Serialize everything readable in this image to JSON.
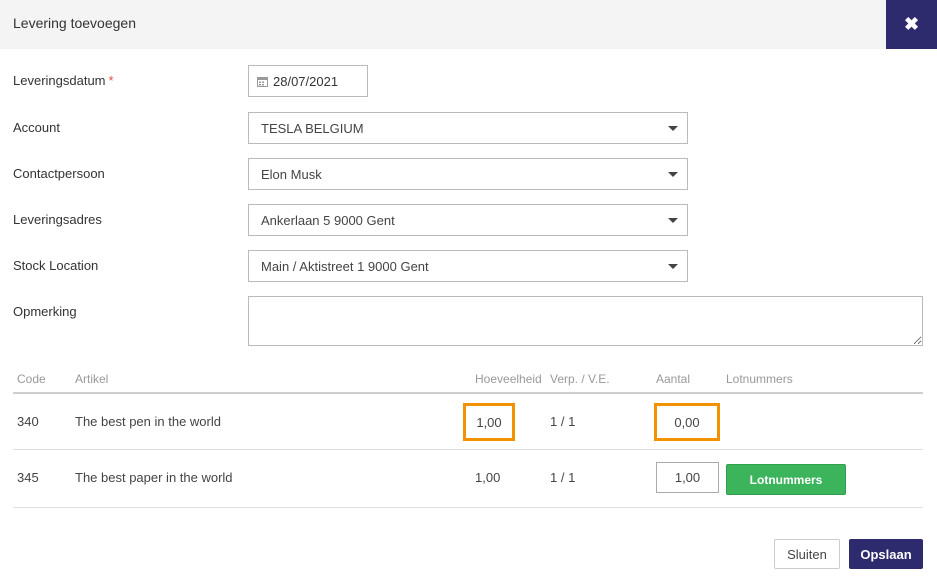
{
  "dialog": {
    "title": "Levering toevoegen",
    "close_icon": "✖"
  },
  "form": {
    "delivery_date": {
      "label": "Leveringsdatum",
      "required_mark": "*",
      "value": "28/07/2021"
    },
    "account": {
      "label": "Account",
      "value": "TESLA BELGIUM"
    },
    "contact": {
      "label": "Contactpersoon",
      "value": "Elon Musk"
    },
    "address": {
      "label": "Leveringsadres",
      "value": "Ankerlaan 5 9000 Gent"
    },
    "stock_location": {
      "label": "Stock Location",
      "value": "Main / Aktistreet 1 9000 Gent"
    },
    "remark": {
      "label": "Opmerking",
      "value": ""
    }
  },
  "table": {
    "headers": [
      "Code",
      "Artikel",
      "Hoeveelheid",
      "Verp. / V.E.",
      "Aantal",
      "Lotnummers"
    ],
    "rows": [
      {
        "code": "340",
        "article": "The best pen in the world",
        "quantity": "1,00",
        "packaging": "1 / 1",
        "amount": "0,00",
        "lot_button": ""
      },
      {
        "code": "345",
        "article": "The best paper in the world",
        "quantity": "1,00",
        "packaging": "1 / 1",
        "amount": "1,00",
        "lot_button": "Lotnummers"
      }
    ]
  },
  "footer": {
    "close_label": "Sluiten",
    "save_label": "Opslaan"
  },
  "colors": {
    "accent": "#2e2a6e",
    "highlight": "#f39200",
    "success": "#3cb45c"
  },
  "icons": {
    "calendar": "calendar-icon",
    "caret": "caret-down-icon",
    "close": "close-icon"
  }
}
